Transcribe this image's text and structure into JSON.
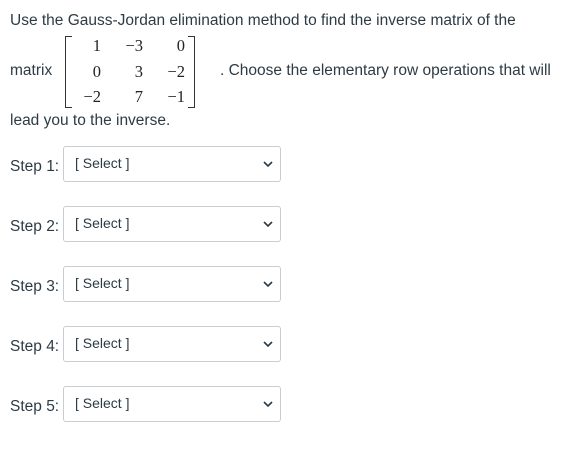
{
  "question": {
    "line1": "Use the Gauss-Jordan elimination method to find the inverse matrix of the",
    "matrix_label": "matrix",
    "matrix": [
      [
        "1",
        "−3",
        "0"
      ],
      [
        "0",
        "3",
        "−2"
      ],
      [
        "−2",
        "7",
        "−1"
      ]
    ],
    "after_matrix": ". Choose the elementary row operations that will",
    "line3": "lead you to the inverse."
  },
  "steps": [
    {
      "label": "Step 1:",
      "value": "[ Select ]"
    },
    {
      "label": "Step 2:",
      "value": "[ Select ]"
    },
    {
      "label": "Step 3:",
      "value": "[ Select ]"
    },
    {
      "label": "Step 4:",
      "value": "[ Select ]"
    },
    {
      "label": "Step 5:",
      "value": "[ Select ]"
    }
  ],
  "icons": {
    "dropdown": "chevron-down-icon"
  },
  "colors": {
    "text": "#2d3b45",
    "border": "#c7cdd1"
  }
}
